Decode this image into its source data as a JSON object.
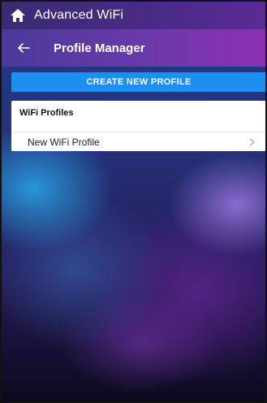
{
  "status_bar": {
    "icon": "home-icon",
    "title": "Advanced WiFi"
  },
  "nav_bar": {
    "back_icon": "back-arrow-icon",
    "title": "Profile Manager"
  },
  "create_button": {
    "label": "CREATE NEW PROFILE",
    "color": "#1f8ef1"
  },
  "profiles": {
    "header": "WiFi Profiles",
    "items": [
      {
        "label": "New WiFi Profile",
        "icon": "chevron-right-icon"
      }
    ]
  }
}
